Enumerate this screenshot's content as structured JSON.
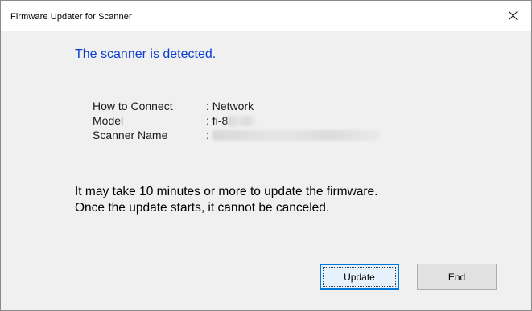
{
  "window": {
    "title": "Firmware Updater for Scanner",
    "close_glyph": "✕"
  },
  "main": {
    "headline": "The scanner is detected.",
    "info": [
      {
        "label": "How to Connect",
        "value": ": Network"
      },
      {
        "label": "Model",
        "value": ": fi-8"
      },
      {
        "label": "Scanner Name",
        "value": ":"
      }
    ],
    "notice_line1": "It may take 10 minutes or more to update the firmware.",
    "notice_line2": "Once the update starts, it cannot be canceled."
  },
  "buttons": {
    "update_label": "Update",
    "end_label": "End"
  },
  "colors": {
    "headline": "#0a3fd0",
    "focus_border": "#0078d7",
    "dialog_bg": "#f0f0f0"
  },
  "icons": {
    "close": "close-icon"
  }
}
